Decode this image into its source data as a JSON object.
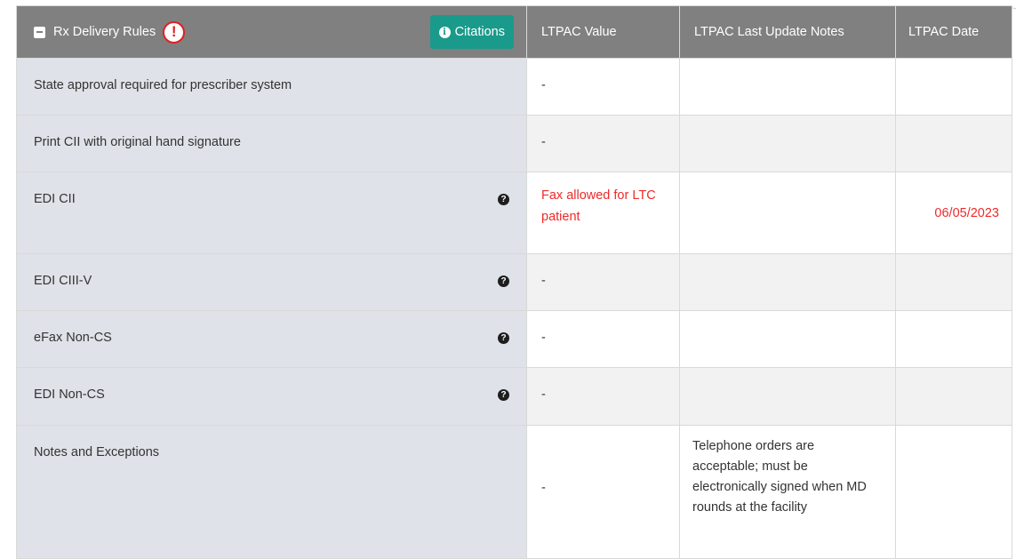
{
  "header": {
    "section_title": "Rx Delivery Rules",
    "alert_symbol": "!",
    "citations_label": "Citations",
    "columns": [
      "LTPAC Value",
      "LTPAC Last Update Notes",
      "LTPAC Date"
    ]
  },
  "rows": [
    {
      "label": "State approval required for prescriber system",
      "has_help": false,
      "value": "-",
      "notes": "",
      "date": ""
    },
    {
      "label": "Print CII with original hand signature",
      "has_help": false,
      "value": "-",
      "notes": "",
      "date": ""
    },
    {
      "label": "EDI CII",
      "has_help": true,
      "value": "Fax allowed for LTC patient",
      "notes": "",
      "date": "06/05/2023"
    },
    {
      "label": "EDI CIII-V",
      "has_help": true,
      "value": "-",
      "notes": "",
      "date": ""
    },
    {
      "label": "eFax Non-CS",
      "has_help": true,
      "value": "-",
      "notes": "",
      "date": ""
    },
    {
      "label": "EDI Non-CS",
      "has_help": true,
      "value": "-",
      "notes": "",
      "date": ""
    },
    {
      "label": "Notes and Exceptions",
      "has_help": false,
      "value": "-",
      "notes": "Telephone orders are acceptable; must be electronically signed when MD rounds at the facility",
      "date": ""
    }
  ],
  "colors": {
    "header_bg": "#808080",
    "citations_bg": "#1a9a8a",
    "alert_red": "#e02020",
    "highlight_text": "#ee2a2a",
    "label_bg": "#dfe2e8",
    "row_alt_bg": "#f2f2f2"
  },
  "icons": {
    "collapse": "minus-square-icon",
    "alert": "exclamation-circle-icon",
    "citations": "info-circle-icon",
    "help": "question-circle-icon"
  }
}
